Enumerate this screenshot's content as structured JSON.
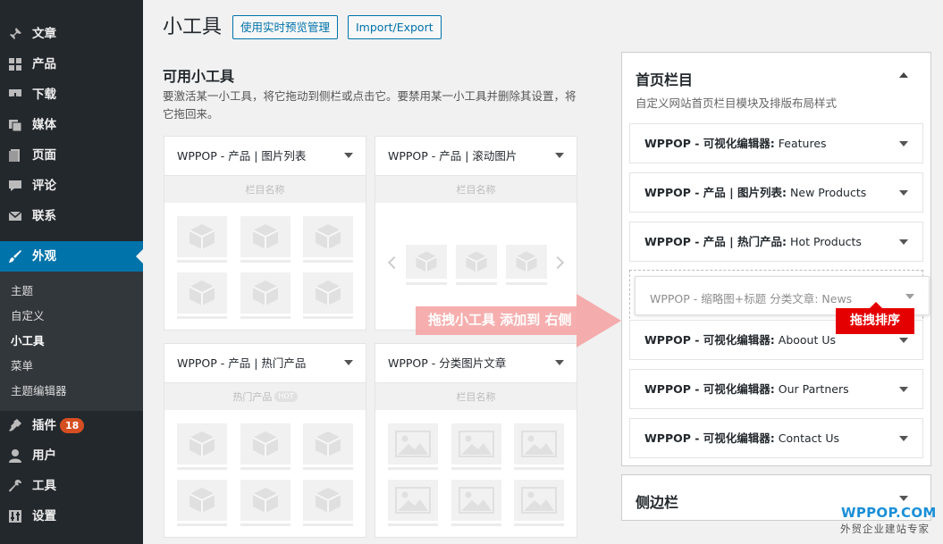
{
  "sidebar": {
    "items": [
      {
        "label": "文章",
        "icon": "pin-icon"
      },
      {
        "label": "产品",
        "icon": "grid-icon"
      },
      {
        "label": "下载",
        "icon": "download-icon"
      },
      {
        "label": "媒体",
        "icon": "media-icon"
      },
      {
        "label": "页面",
        "icon": "page-icon"
      },
      {
        "label": "评论",
        "icon": "comment-icon"
      },
      {
        "label": "联系",
        "icon": "mail-icon"
      },
      {
        "label": "外观",
        "icon": "brush-icon"
      },
      {
        "label": "插件",
        "icon": "plugin-icon",
        "badge": "18"
      },
      {
        "label": "用户",
        "icon": "user-icon"
      },
      {
        "label": "工具",
        "icon": "wrench-icon"
      },
      {
        "label": "设置",
        "icon": "settings-icon"
      }
    ],
    "submenu": [
      "主题",
      "自定义",
      "小工具",
      "菜单",
      "主题编辑器"
    ]
  },
  "header": {
    "title": "小工具",
    "live_preview_label": "使用实时预览管理",
    "import_export_label": "Import/Export"
  },
  "available": {
    "title": "可用小工具",
    "description": "要激活某一小工具，将它拖动到侧栏或点击它。要禁用某一小工具并删除其设置，将它拖回来。",
    "widgets": [
      {
        "title": "WPPOP - 产品 | 图片列表",
        "label": "栏目名称"
      },
      {
        "title": "WPPOP - 产品 | 滚动图片",
        "label": "栏目名称"
      },
      {
        "title": "WPPOP - 产品 | 热门产品",
        "label": "热门产品",
        "tag": "HOT"
      },
      {
        "title": "WPPOP - 分类图片文章",
        "label": "栏目名称"
      }
    ]
  },
  "drag_hint": "拖拽小工具 添加到 右侧",
  "home_area": {
    "title": "首页栏目",
    "description": "自定义网站首页栏目模块及排版布局样式",
    "items": [
      {
        "prefix": "WPPOP - 可视化编辑器:",
        "name": "Features"
      },
      {
        "prefix": "WPPOP - 产品 | 图片列表:",
        "name": "New Products"
      },
      {
        "prefix": "WPPOP - 产品 | 热门产品:",
        "name": "Hot Products"
      },
      {
        "prefix": "WPPOP - 可视化编辑器:",
        "name": "Aboout Us"
      },
      {
        "prefix": "WPPOP - 可视化编辑器:",
        "name": "Our Partners"
      },
      {
        "prefix": "WPPOP - 可视化编辑器:",
        "name": "Contact Us"
      }
    ],
    "dragging_item": "WPPOP - 缩略图+标题 分类文章: News",
    "sort_label": "拖拽排序"
  },
  "sidebar_area": {
    "title": "侧边栏"
  },
  "brand": {
    "name": "WPPOP.COM",
    "tagline": "外贸企业建站专家"
  },
  "colors": {
    "admin_bar": "#23282d",
    "accent": "#0073aa",
    "badge": "#d54e21",
    "hint": "#f28b8b",
    "sort_tag": "#e40000",
    "brand": "#1a8fd8"
  }
}
